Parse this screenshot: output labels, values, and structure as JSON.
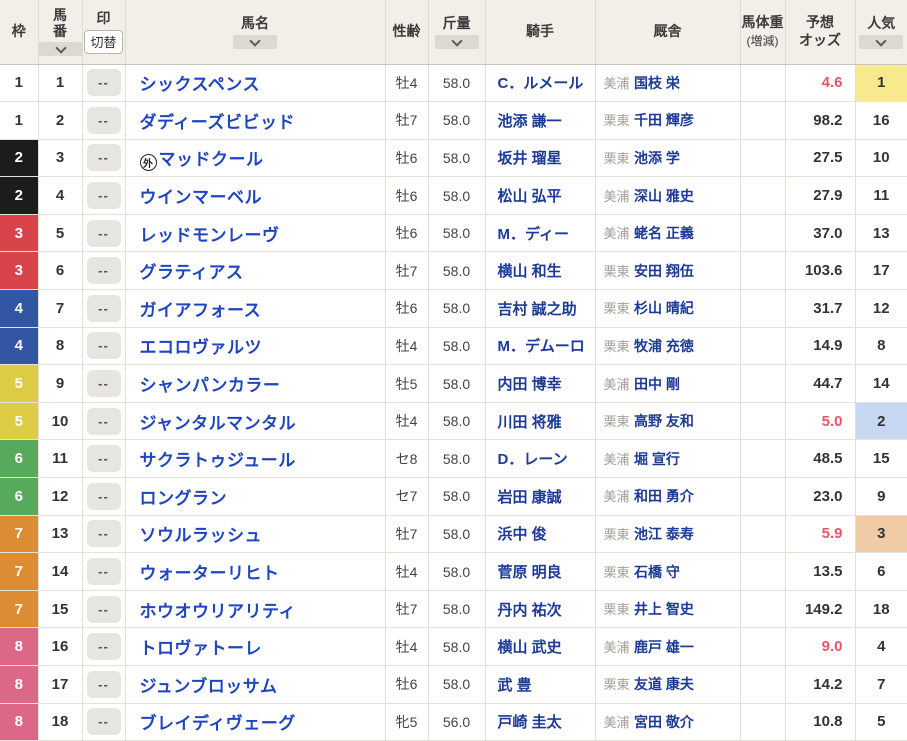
{
  "table": {
    "headers": {
      "waku": "枠",
      "umaban": "馬番",
      "mark": "印",
      "mark_toggle": "切替",
      "name": "馬名",
      "sex_age": "性齢",
      "weight": "斤量",
      "jockey": "騎手",
      "stable": "厩舎",
      "body_weight_line1": "馬体重",
      "body_weight_line2": "(増減)",
      "odds": "予想\nオッズ",
      "popularity": "人気"
    },
    "sort_icon": "chevron-down"
  },
  "colors": {
    "header_bg": "#f2efe8",
    "row_bg": "#ffffff",
    "name_link": "#1e44c0",
    "link_navy": "#1d3a96",
    "region_gray": "#a09e96",
    "odds_favorite_red": "#e8546b",
    "text_dark": "#333333",
    "frames": [
      {
        "frame": 1,
        "bg": "#ffffff",
        "fg": "#333333"
      },
      {
        "frame": 2,
        "bg": "#1c1c1c",
        "fg": "#ffffff"
      },
      {
        "frame": 3,
        "bg": "#d9444b",
        "fg": "#ffffff"
      },
      {
        "frame": 4,
        "bg": "#3356a4",
        "fg": "#ffffff"
      },
      {
        "frame": 5,
        "bg": "#decb44",
        "fg": "#ffffff"
      },
      {
        "frame": 6,
        "bg": "#57a95c",
        "fg": "#ffffff"
      },
      {
        "frame": 7,
        "bg": "#dc8c33",
        "fg": "#ffffff"
      },
      {
        "frame": 8,
        "bg": "#dd6787",
        "fg": "#ffffff"
      }
    ],
    "popularity_highlight": {
      "1": "#f8e98e",
      "2": "#c6d7f1",
      "3": "#f0cba5"
    }
  },
  "horses": [
    {
      "frame": 1,
      "number": "1",
      "mark": "--",
      "gai": false,
      "gai_char": "外",
      "name": "シックスペンス",
      "sex_age": "牡4",
      "weight": "58.0",
      "jockey": "C．ルメール",
      "region": "美浦",
      "trainer": "国枝 栄",
      "body_weight": "",
      "odds": "4.6",
      "odds_red": true,
      "popularity": "1"
    },
    {
      "frame": 1,
      "number": "2",
      "mark": "--",
      "gai": false,
      "gai_char": "外",
      "name": "ダディーズビビッド",
      "sex_age": "牡7",
      "weight": "58.0",
      "jockey": "池添 謙一",
      "region": "栗東",
      "trainer": "千田 輝彦",
      "body_weight": "",
      "odds": "98.2",
      "odds_red": false,
      "popularity": "16"
    },
    {
      "frame": 2,
      "number": "3",
      "mark": "--",
      "gai": true,
      "gai_char": "外",
      "name": "マッドクール",
      "sex_age": "牡6",
      "weight": "58.0",
      "jockey": "坂井 瑠星",
      "region": "栗東",
      "trainer": "池添 学",
      "body_weight": "",
      "odds": "27.5",
      "odds_red": false,
      "popularity": "10"
    },
    {
      "frame": 2,
      "number": "4",
      "mark": "--",
      "gai": false,
      "gai_char": "外",
      "name": "ウインマーベル",
      "sex_age": "牡6",
      "weight": "58.0",
      "jockey": "松山 弘平",
      "region": "美浦",
      "trainer": "深山 雅史",
      "body_weight": "",
      "odds": "27.9",
      "odds_red": false,
      "popularity": "11"
    },
    {
      "frame": 3,
      "number": "5",
      "mark": "--",
      "gai": false,
      "gai_char": "外",
      "name": "レッドモンレーヴ",
      "sex_age": "牡6",
      "weight": "58.0",
      "jockey": "M．ディー",
      "region": "美浦",
      "trainer": "蛯名 正義",
      "body_weight": "",
      "odds": "37.0",
      "odds_red": false,
      "popularity": "13"
    },
    {
      "frame": 3,
      "number": "6",
      "mark": "--",
      "gai": false,
      "gai_char": "外",
      "name": "グラティアス",
      "sex_age": "牡7",
      "weight": "58.0",
      "jockey": "横山 和生",
      "region": "栗東",
      "trainer": "安田 翔伍",
      "body_weight": "",
      "odds": "103.6",
      "odds_red": false,
      "popularity": "17"
    },
    {
      "frame": 4,
      "number": "7",
      "mark": "--",
      "gai": false,
      "gai_char": "外",
      "name": "ガイアフォース",
      "sex_age": "牡6",
      "weight": "58.0",
      "jockey": "吉村 誠之助",
      "region": "栗東",
      "trainer": "杉山 晴紀",
      "body_weight": "",
      "odds": "31.7",
      "odds_red": false,
      "popularity": "12"
    },
    {
      "frame": 4,
      "number": "8",
      "mark": "--",
      "gai": false,
      "gai_char": "外",
      "name": "エコロヴァルツ",
      "sex_age": "牡4",
      "weight": "58.0",
      "jockey": "M．デムーロ",
      "region": "栗東",
      "trainer": "牧浦 充徳",
      "body_weight": "",
      "odds": "14.9",
      "odds_red": false,
      "popularity": "8"
    },
    {
      "frame": 5,
      "number": "9",
      "mark": "--",
      "gai": false,
      "gai_char": "外",
      "name": "シャンパンカラー",
      "sex_age": "牡5",
      "weight": "58.0",
      "jockey": "内田 博幸",
      "region": "美浦",
      "trainer": "田中 剛",
      "body_weight": "",
      "odds": "44.7",
      "odds_red": false,
      "popularity": "14"
    },
    {
      "frame": 5,
      "number": "10",
      "mark": "--",
      "gai": false,
      "gai_char": "外",
      "name": "ジャンタルマンタル",
      "sex_age": "牡4",
      "weight": "58.0",
      "jockey": "川田 将雅",
      "region": "栗東",
      "trainer": "高野 友和",
      "body_weight": "",
      "odds": "5.0",
      "odds_red": true,
      "popularity": "2"
    },
    {
      "frame": 6,
      "number": "11",
      "mark": "--",
      "gai": false,
      "gai_char": "外",
      "name": "サクラトゥジュール",
      "sex_age": "セ8",
      "weight": "58.0",
      "jockey": "D．レーン",
      "region": "美浦",
      "trainer": "堀 宣行",
      "body_weight": "",
      "odds": "48.5",
      "odds_red": false,
      "popularity": "15"
    },
    {
      "frame": 6,
      "number": "12",
      "mark": "--",
      "gai": false,
      "gai_char": "外",
      "name": "ロングラン",
      "sex_age": "セ7",
      "weight": "58.0",
      "jockey": "岩田 康誠",
      "region": "美浦",
      "trainer": "和田 勇介",
      "body_weight": "",
      "odds": "23.0",
      "odds_red": false,
      "popularity": "9"
    },
    {
      "frame": 7,
      "number": "13",
      "mark": "--",
      "gai": false,
      "gai_char": "外",
      "name": "ソウルラッシュ",
      "sex_age": "牡7",
      "weight": "58.0",
      "jockey": "浜中 俊",
      "region": "栗東",
      "trainer": "池江 泰寿",
      "body_weight": "",
      "odds": "5.9",
      "odds_red": true,
      "popularity": "3"
    },
    {
      "frame": 7,
      "number": "14",
      "mark": "--",
      "gai": false,
      "gai_char": "外",
      "name": "ウォーターリヒト",
      "sex_age": "牡4",
      "weight": "58.0",
      "jockey": "菅原 明良",
      "region": "栗東",
      "trainer": "石橋 守",
      "body_weight": "",
      "odds": "13.5",
      "odds_red": false,
      "popularity": "6"
    },
    {
      "frame": 7,
      "number": "15",
      "mark": "--",
      "gai": false,
      "gai_char": "外",
      "name": "ホウオウリアリティ",
      "sex_age": "牡7",
      "weight": "58.0",
      "jockey": "丹内 祐次",
      "region": "栗東",
      "trainer": "井上 智史",
      "body_weight": "",
      "odds": "149.2",
      "odds_red": false,
      "popularity": "18"
    },
    {
      "frame": 8,
      "number": "16",
      "mark": "--",
      "gai": false,
      "gai_char": "外",
      "name": "トロヴァトーレ",
      "sex_age": "牡4",
      "weight": "58.0",
      "jockey": "横山 武史",
      "region": "美浦",
      "trainer": "鹿戸 雄一",
      "body_weight": "",
      "odds": "9.0",
      "odds_red": true,
      "popularity": "4"
    },
    {
      "frame": 8,
      "number": "17",
      "mark": "--",
      "gai": false,
      "gai_char": "外",
      "name": "ジュンブロッサム",
      "sex_age": "牡6",
      "weight": "58.0",
      "jockey": "武 豊",
      "region": "栗東",
      "trainer": "友道 康夫",
      "body_weight": "",
      "odds": "14.2",
      "odds_red": false,
      "popularity": "7"
    },
    {
      "frame": 8,
      "number": "18",
      "mark": "--",
      "gai": false,
      "gai_char": "外",
      "name": "ブレイディヴェーグ",
      "sex_age": "牝5",
      "weight": "56.0",
      "jockey": "戸崎 圭太",
      "region": "美浦",
      "trainer": "宮田 敬介",
      "body_weight": "",
      "odds": "10.8",
      "odds_red": false,
      "popularity": "5"
    }
  ]
}
